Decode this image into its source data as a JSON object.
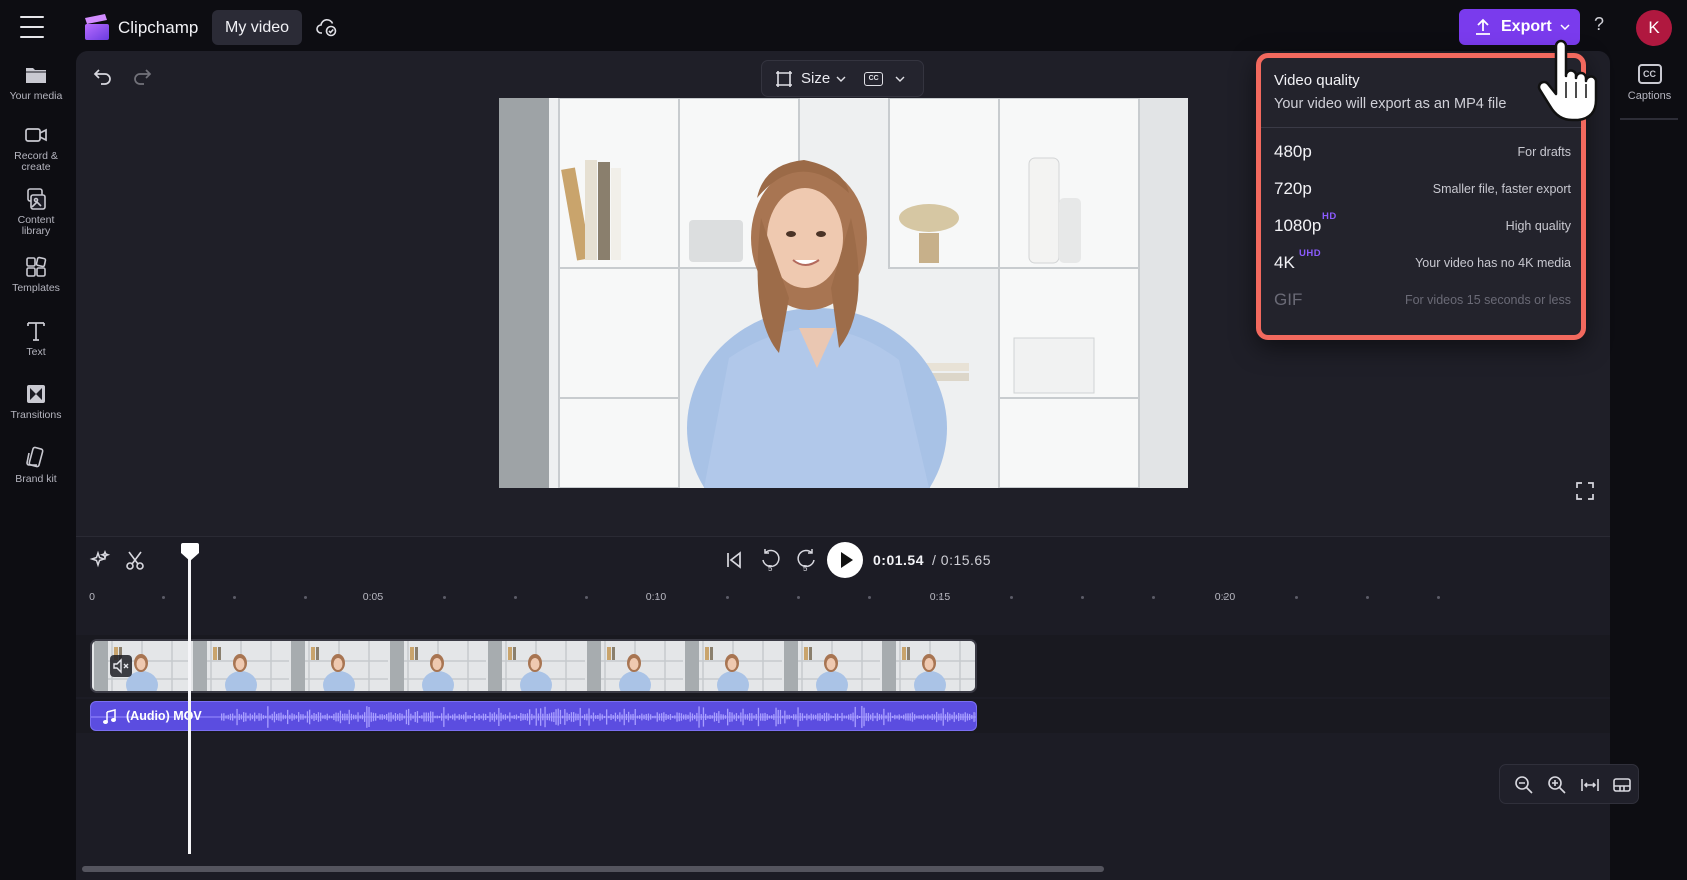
{
  "app": {
    "name": "Clipchamp",
    "project_title": "My video",
    "avatar_initial": "K"
  },
  "header": {
    "export_label": "Export",
    "help_label": "?"
  },
  "sidebar": {
    "items": [
      {
        "label": "Your media",
        "icon": "folder-icon"
      },
      {
        "label": "Record &\ncreate",
        "icon": "camera-icon"
      },
      {
        "label": "Content\nlibrary",
        "icon": "content-library-icon"
      },
      {
        "label": "Templates",
        "icon": "templates-icon"
      },
      {
        "label": "Text",
        "icon": "text-icon"
      },
      {
        "label": "Transitions",
        "icon": "transitions-icon"
      },
      {
        "label": "Brand kit",
        "icon": "brand-kit-icon"
      }
    ]
  },
  "right_sidebar": {
    "captions_label": "Captions",
    "captions_icon_text": "CC"
  },
  "preview": {
    "size_label": "Size",
    "cc_label": "CC"
  },
  "playback": {
    "current_time": "0:01.54",
    "total_time": "/ 0:15.65"
  },
  "ruler": {
    "labels": [
      "0",
      "0:05",
      "0:10",
      "0:15",
      "0:20"
    ]
  },
  "timeline": {
    "audio_clip_label": "(Audio) MOV"
  },
  "export_menu": {
    "title": "Video quality",
    "subtitle": "Your video will export as an MP4 file",
    "options": [
      {
        "resolution": "480p",
        "badge": "",
        "description": "For drafts",
        "enabled": true
      },
      {
        "resolution": "720p",
        "badge": "",
        "description": "Smaller file, faster export",
        "enabled": true
      },
      {
        "resolution": "1080p",
        "badge": "HD",
        "description": "High quality",
        "enabled": true
      },
      {
        "resolution": "4K",
        "badge": "UHD",
        "description": "Your video has no 4K media",
        "enabled": true
      },
      {
        "resolution": "GIF",
        "badge": "",
        "description": "For videos 15 seconds or less",
        "enabled": false
      }
    ]
  },
  "colors": {
    "accent": "#7a3bed",
    "highlight_border": "#f2695e",
    "avatar": "#b0183f",
    "audio_clip": "#5b4de0"
  }
}
